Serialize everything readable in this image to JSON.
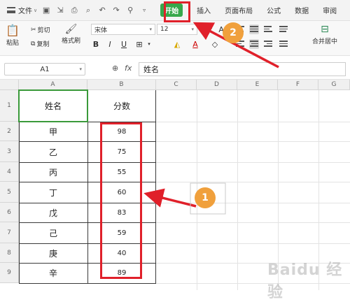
{
  "menubar": {
    "file_label": "文件",
    "tabs": [
      "开始",
      "插入",
      "页面布局",
      "公式",
      "数据",
      "审阅"
    ]
  },
  "ribbon": {
    "paste": "粘贴",
    "cut": "剪切",
    "copy": "复制",
    "format_painter": "格式刷",
    "font_name": "宋体",
    "font_size": "12",
    "merge_center": "合并居中"
  },
  "formula_bar": {
    "cell_ref": "A1",
    "fx_label": "fx",
    "content": "姓名"
  },
  "columns": [
    "A",
    "B",
    "C",
    "D",
    "E",
    "F",
    "G"
  ],
  "rows": [
    "1",
    "2",
    "3",
    "4",
    "5",
    "6",
    "7",
    "8",
    "9"
  ],
  "table": {
    "headers": [
      "姓名",
      "分数"
    ],
    "names": [
      "甲",
      "乙",
      "丙",
      "丁",
      "戊",
      "己",
      "庚",
      "辛"
    ],
    "scores": [
      "98",
      "75",
      "55",
      "60",
      "83",
      "59",
      "40",
      "89"
    ]
  },
  "annotations": {
    "badge1": "1",
    "badge2": "2",
    "color": "#e0202a",
    "badge_color": "#f0a03c"
  },
  "watermark": "Baidu 经验",
  "accent": "#36a84b"
}
